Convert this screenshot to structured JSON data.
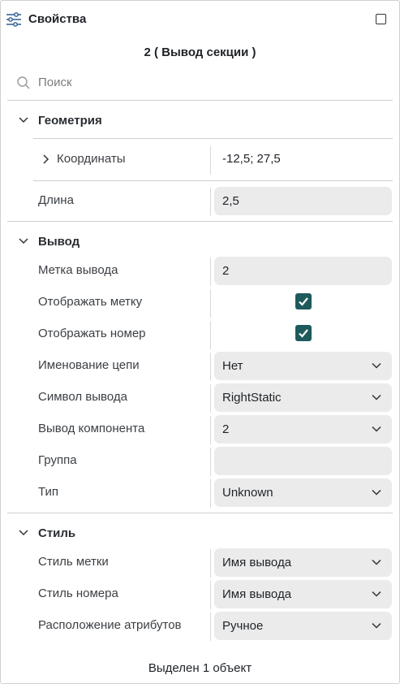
{
  "header": {
    "title": "Свойства",
    "filter_icon": "sliders-icon",
    "maximize_icon": "maximize-square-icon"
  },
  "subtitle": "2 ( Вывод секции )",
  "search": {
    "placeholder": "Поиск",
    "value": ""
  },
  "geometry": {
    "title": "Геометрия",
    "coordinates": {
      "label": "Координаты",
      "value": "-12,5; 27,5"
    },
    "length": {
      "label": "Длина",
      "value": "2,5"
    }
  },
  "pin": {
    "title": "Вывод",
    "pin_label": {
      "label": "Метка вывода",
      "value": "2"
    },
    "show_label": {
      "label": "Отображать метку",
      "checked": true
    },
    "show_number": {
      "label": "Отображать номер",
      "checked": true
    },
    "net_naming": {
      "label": "Именование цепи",
      "value": "Нет"
    },
    "pin_symbol": {
      "label": "Символ вывода",
      "value": "RightStatic"
    },
    "component_pin": {
      "label": "Вывод компонента",
      "value": "2"
    },
    "group": {
      "label": "Группа",
      "value": ""
    },
    "type": {
      "label": "Тип",
      "value": "Unknown"
    }
  },
  "style": {
    "title": "Стиль",
    "label_style": {
      "label": "Стиль метки",
      "value": "Имя вывода"
    },
    "number_style": {
      "label": "Стиль номера",
      "value": "Имя вывода"
    },
    "attr_placement": {
      "label": "Расположение атрибутов",
      "value": "Ручное"
    }
  },
  "footer": "Выделен 1 объект",
  "colors": {
    "accent": "#1e5a5c",
    "field_bg": "#ebebeb",
    "divider": "#cfcfcf"
  }
}
